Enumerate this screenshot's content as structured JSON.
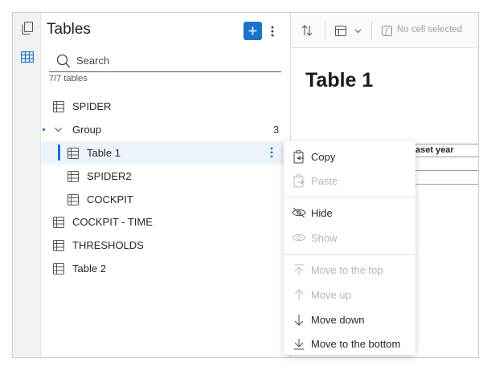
{
  "panel": {
    "title": "Tables",
    "search_placeholder": "Search",
    "count_text": "7/7 tables"
  },
  "tables": [
    {
      "label": "SPIDER"
    },
    {
      "label": "Group",
      "count": "3"
    },
    {
      "label": "Table 1"
    },
    {
      "label": "SPIDER2"
    },
    {
      "label": "COCKPIT"
    },
    {
      "label": "COCKPIT - TIME"
    },
    {
      "label": "THRESHOLDS"
    },
    {
      "label": "Table 2"
    }
  ],
  "toolbar": {
    "cell_status": "No cell selected"
  },
  "main": {
    "title": "Table 1",
    "column_header": "aset year"
  },
  "context_menu": {
    "copy": "Copy",
    "paste": "Paste",
    "hide": "Hide",
    "show": "Show",
    "move_top": "Move to the top",
    "move_up": "Move up",
    "move_down": "Move down",
    "move_bottom": "Move to the bottom"
  },
  "colors": {
    "accent": "#1a73c8",
    "selected_row_bg": "#edf3fb",
    "disabled_text": "#b5b5b5"
  }
}
